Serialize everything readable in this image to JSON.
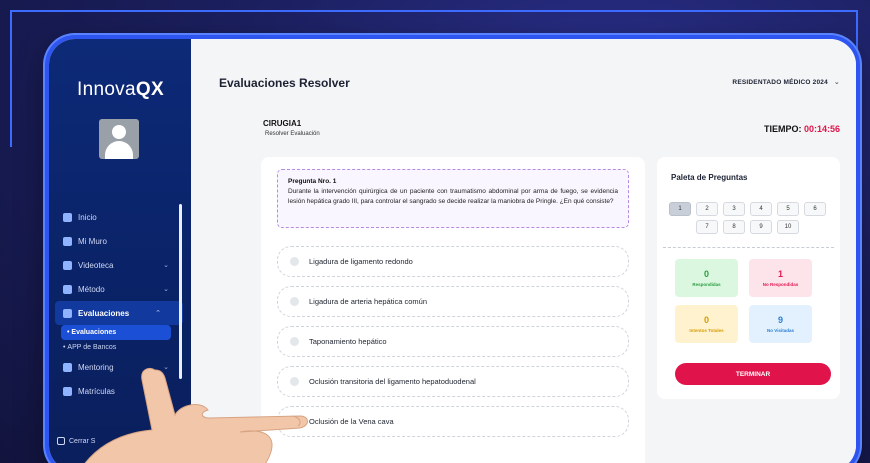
{
  "app": {
    "brand": "Innova",
    "brand_bold": "QX"
  },
  "header": {
    "title": "Evaluaciones Resolver",
    "role": "RESIDENTADO MÉDICO 2024"
  },
  "sidebar": {
    "items": [
      {
        "label": "Inicio",
        "icon": "home-icon"
      },
      {
        "label": "Mi Muro",
        "icon": "grid-icon"
      },
      {
        "label": "Videoteca",
        "icon": "video-icon"
      },
      {
        "label": "Método",
        "icon": "method-icon"
      },
      {
        "label": "Evaluaciones",
        "icon": "exam-icon"
      },
      {
        "label": "Mentoring",
        "icon": "mentoring-icon"
      },
      {
        "label": "Matrículas",
        "icon": "enroll-icon"
      }
    ],
    "subitems": [
      "Evaluaciones",
      "APP de Bancos"
    ],
    "logout": "Cerrar S"
  },
  "exam": {
    "course": "CIRUGIA1",
    "course_sub": "Resolver Evaluación",
    "timer_label": "TIEMPO:",
    "timer_value": "00:14:56"
  },
  "question": {
    "number": "Pregunta Nro. 1",
    "text": "Durante la intervención quirúrgica de un paciente con traumatismo abdominal por arma de fuego, se evidencia lesión hepática grado III, para controlar el sangrado se decide realizar la maniobra de Pringle. ¿En qué consiste?",
    "options": [
      "Ligadura de ligamento redondo",
      "Ligadura de arteria hepática común",
      "Taponamiento hepático",
      "Oclusión transitoria del ligamento hepatoduodenal",
      "Oclusión de la Vena cava"
    ]
  },
  "palette": {
    "title": "Paleta de Preguntas",
    "numbers": [
      "1",
      "2",
      "3",
      "4",
      "5",
      "6",
      "7",
      "8",
      "9",
      "10"
    ],
    "current": "1",
    "stats": {
      "responded": {
        "n": "0",
        "label": "Respondidas"
      },
      "not_responded": {
        "n": "1",
        "label": "No Respondidas"
      },
      "attempts": {
        "n": "0",
        "label": "Intentos Totales"
      },
      "not_visited": {
        "n": "9",
        "label": "No Visitadas"
      }
    },
    "finish": "TERMINAR"
  },
  "colors": {
    "accent": "#e0144a",
    "sidebar": "#0a2266",
    "device": "#2e55f0"
  }
}
